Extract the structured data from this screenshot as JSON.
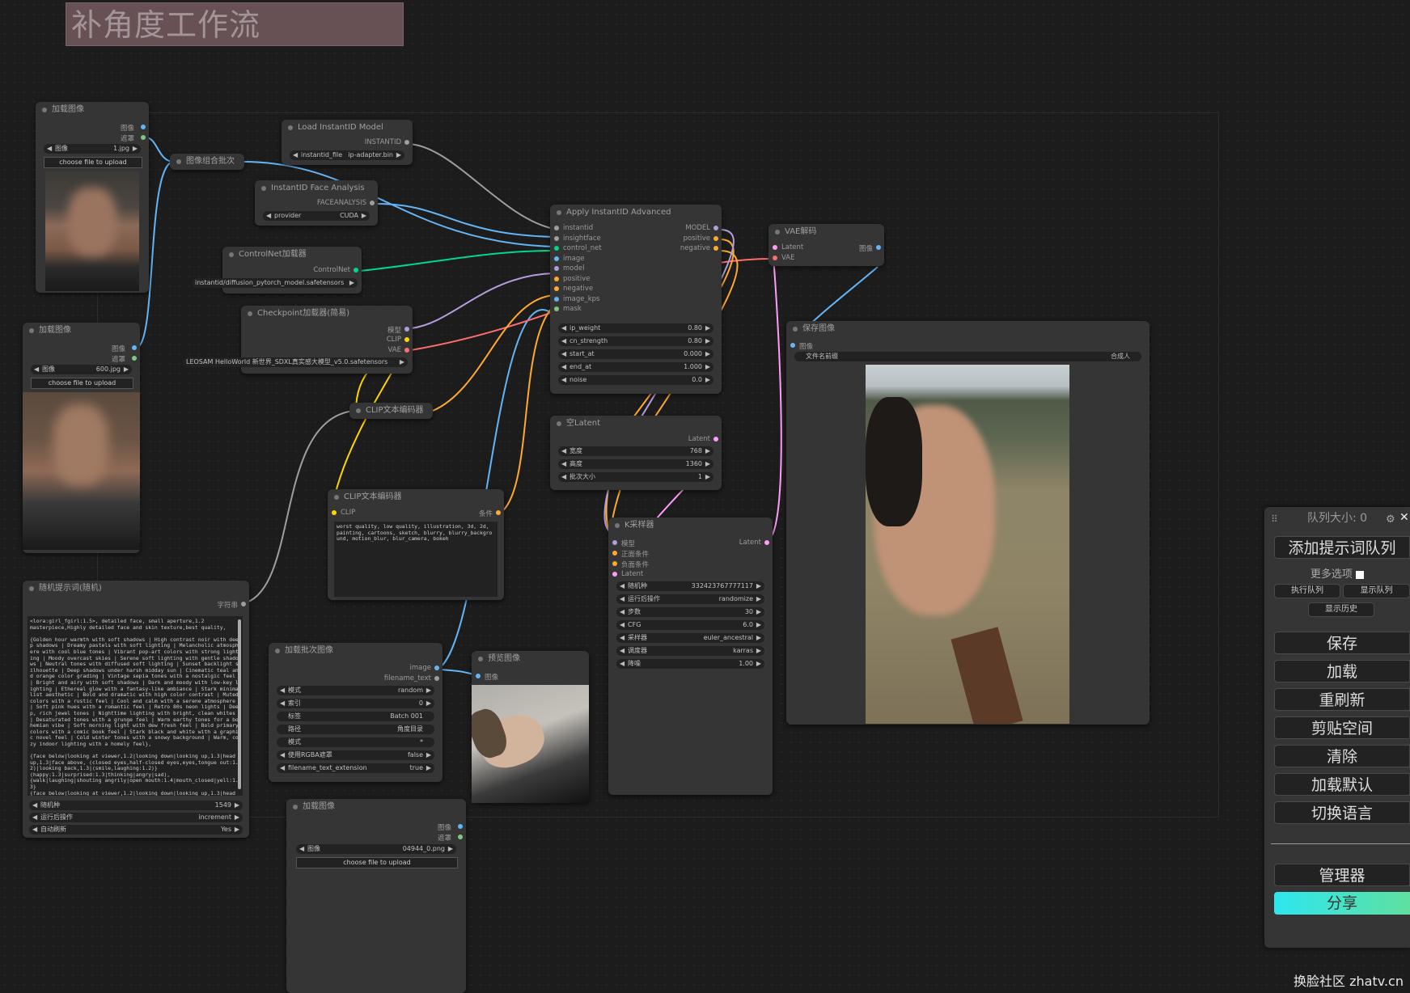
{
  "workflow_title": "补角度工作流",
  "colors": {
    "image_wire": "#64b5f6",
    "clip_wire": "#ffd500",
    "model_wire": "#b39ddb",
    "vae_wire": "#ff6e6e",
    "conditioning_wire": "#ffa931",
    "latent_wire": "#ff9cf9",
    "controlnet_wire": "#00d78d",
    "generic_wire": "#9e9e9e"
  },
  "nodes": {
    "load_image_1": {
      "title": "加载图像",
      "out_image": "图像",
      "out_mask": "遮罩",
      "widget_label": "图像",
      "widget_value": "1.jpg",
      "upload": "choose file to upload"
    },
    "load_image_2": {
      "title": "加载图像",
      "out_image": "图像",
      "out_mask": "遮罩",
      "widget_label": "图像",
      "widget_value": "600.jpg",
      "upload": "choose file to upload"
    },
    "image_batch": {
      "title": "图像组合批次"
    },
    "load_instantid": {
      "title": "Load InstantID Model",
      "out": "INSTANTID",
      "widget_label": "instantid_file",
      "widget_value": "ip-adapter.bin"
    },
    "face_analysis": {
      "title": "InstantID Face Analysis",
      "out": "FACEANALYSIS",
      "widget_label": "provider",
      "widget_value": "CUDA"
    },
    "controlnet_loader": {
      "title": "ControlNet加载器",
      "out": "ControlNet",
      "widget_value": "instantid/diffusion_pytorch_model.safetensors"
    },
    "checkpoint_loader": {
      "title": "Checkpoint加载器(简易)",
      "out_model": "模型",
      "out_clip": "CLIP",
      "out_vae": "VAE",
      "widget_value": "LEOSAM HelloWorld 新世界_SDXL真实感大模型_v5.0.safetensors"
    },
    "apply_instantid": {
      "title": "Apply InstantID Advanced",
      "inputs": [
        "instantid",
        "insightface",
        "control_net",
        "image",
        "model",
        "positive",
        "negative",
        "image_kps",
        "mask"
      ],
      "outputs": [
        "MODEL",
        "positive",
        "negative"
      ],
      "widgets": [
        {
          "label": "ip_weight",
          "value": "0.80"
        },
        {
          "label": "cn_strength",
          "value": "0.80"
        },
        {
          "label": "start_at",
          "value": "0.000"
        },
        {
          "label": "end_at",
          "value": "1.000"
        },
        {
          "label": "noise",
          "value": "0.0"
        }
      ]
    },
    "vae_decode": {
      "title": "VAE解码",
      "in_latent": "Latent",
      "in_vae": "VAE",
      "out": "图像"
    },
    "save_image": {
      "title": "保存图像",
      "in": "图像",
      "widget_label": "文件名前缀",
      "widget_value": "合成人"
    },
    "clip_encode_1": {
      "title": "CLIP文本编码器"
    },
    "clip_encode_2": {
      "title": "CLIP文本编码器",
      "in": "CLIP",
      "out": "条件",
      "text": "worst quality, low quality, illustration, 3d, 2d, painting, cartoons, sketch, blurry, blurry_background, motion_blur, blur_camera, bokeh"
    },
    "empty_latent": {
      "title": "空Latent",
      "out": "Latent",
      "widgets": [
        {
          "label": "宽度",
          "value": "768"
        },
        {
          "label": "高度",
          "value": "1360"
        },
        {
          "label": "批次大小",
          "value": "1"
        }
      ]
    },
    "ksampler": {
      "title": "K采样器",
      "inputs": [
        "模型",
        "正面条件",
        "负面条件",
        "Latent"
      ],
      "out": "Latent",
      "widgets": [
        {
          "label": "随机种",
          "value": "332423767777117"
        },
        {
          "label": "运行后操作",
          "value": "randomize"
        },
        {
          "label": "步数",
          "value": "30"
        },
        {
          "label": "CFG",
          "value": "6.0"
        },
        {
          "label": "采样器",
          "value": "euler_ancestral"
        },
        {
          "label": "调度器",
          "value": "karras"
        },
        {
          "label": "降噪",
          "value": "1.00"
        }
      ]
    },
    "random_prompt": {
      "title": "随机提示词(随机)",
      "out": "字符串",
      "text": "<lora:girl_fgirl:1.5>, detailed face, small aperture,1.2\nmasterpiece,Highly detailed face and skin texture,best quality,\n\n{Golden hour warmth with soft shadows | High contrast noir with deep shadows | Dreamy pastels with soft lighting | Melancholic atmosphere with cool blue tones | Vibrant pop-art colors with strong lighting | Moody overcast skies | Serene soft lighting with gentle shadows | Neutral tones with diffused soft lighting | Sunset backlight silhouette | Deep shadows under harsh midday sun | Cinematic teal and orange color grading | Vintage sepia tones with a nostalgic feel | Bright and airy with soft shadows | Dark and moody with low-key lighting | Ethereal glow with a fantasy-like ambiance | Stark minimalist aesthetic | Bold and dramatic with high color contrast | Muted colors with a rustic feel | Cool and calm with a serene atmosphere | Soft pink hues with a romantic feel | Retro 80s neon lights | Deep, rich jewel tones | Nighttime lighting with bright, clean whites | Desaturated tones with a grunge feel | Warm earthy tones for a bohemian vibe | Soft morning light with dew fresh feel | Bold primary colors with a comic book feel | Stark black and white with a graphic novel feel | Cold winter tones with a snowy background | Warm, cozy indoor lighting with a homely feel},\n\n{face below|looking at viewer,1.2|looking down|looking up,1.3|head up,1.3|face above, (closed eyes,half-closed eyes,eyes,tongue out:1.2)|looking back,1.3|(smile,laughing:1.2)}\n(happy:1.3|surprised:1.3|thinking|angry|sad),\n{walk|laughing|shouting angrily|open mouth:1.4|mouth_closed|yell:1.3}\n{face below|looking at viewer,1.2|looking down|looking up,1.3|head up,1.3|face above, (closed eyes,half-closed eyes,tongue out:1.2)}",
      "widgets": [
        {
          "label": "随机种",
          "value": "1549"
        },
        {
          "label": "运行后操作",
          "value": "increment"
        },
        {
          "label": "自动刷新",
          "value": "Yes"
        }
      ]
    },
    "load_batch": {
      "title": "加载批次图像",
      "out_image": "image",
      "out_filename": "filename_text",
      "widgets": [
        {
          "label": "模式",
          "value": "random"
        },
        {
          "label": "索引",
          "value": "0"
        },
        {
          "label": "标签",
          "value": "Batch 001"
        },
        {
          "label": "路径",
          "value": "角度目录"
        },
        {
          "label": "模式",
          "value": "*"
        },
        {
          "label": "使用RGBA遮罩",
          "value": "false"
        },
        {
          "label": "filename_text_extension",
          "value": "true"
        }
      ]
    },
    "preview_image": {
      "title": "预览图像",
      "in": "图像"
    },
    "load_image_3": {
      "title": "加载图像",
      "out_image": "图像",
      "out_mask": "遮罩",
      "widget_label": "图像",
      "widget_value": "04944_0.png",
      "upload": "choose file to upload"
    }
  },
  "menu": {
    "queue_size_label": "队列大小: 0",
    "queue_prompt": "添加提示词队列",
    "extra_options": "更多选项",
    "view_queue": "执行队列",
    "view_queue2": "显示队列",
    "view_history": "显示历史",
    "save": "保存",
    "load": "加载",
    "refresh": "重刷新",
    "clipspace": "剪贴空间",
    "clear": "清除",
    "load_default": "加载默认",
    "switch_locale": "切换语言",
    "manager": "管理器",
    "share": "分享"
  },
  "watermark": "换脸社区 zhatv.cn"
}
